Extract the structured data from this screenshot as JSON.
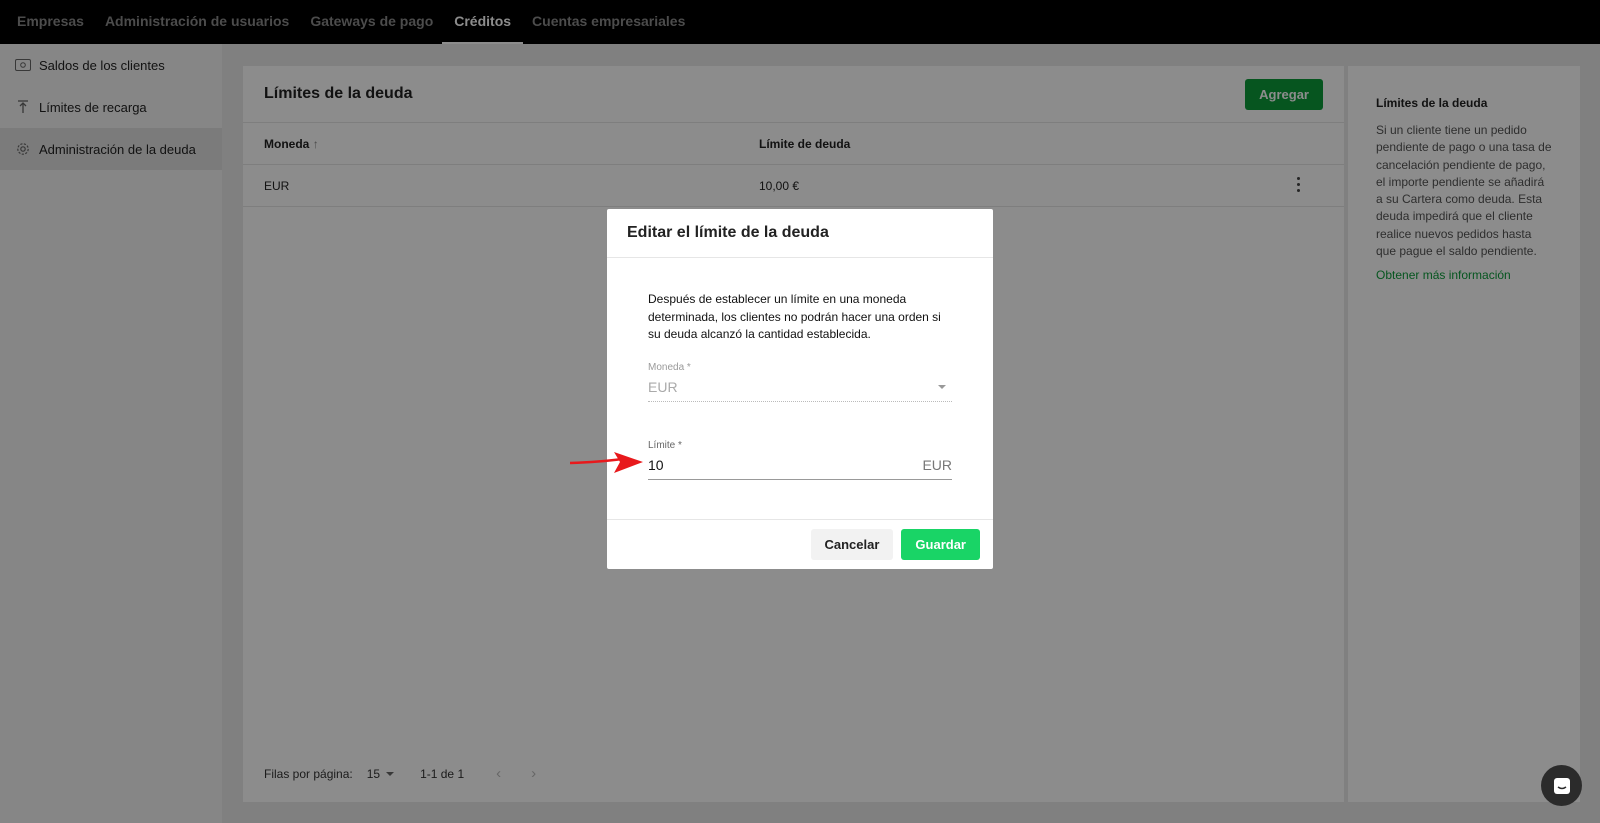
{
  "topnav": {
    "tabs": [
      {
        "label": "Empresas"
      },
      {
        "label": "Administración de usuarios"
      },
      {
        "label": "Gateways de pago"
      },
      {
        "label": "Créditos",
        "active": true
      },
      {
        "label": "Cuentas empresariales"
      }
    ]
  },
  "sidebar": {
    "items": [
      {
        "label": "Saldos de los clientes",
        "icon": "cash-icon"
      },
      {
        "label": "Límites de recarga",
        "icon": "upload-limit-icon"
      },
      {
        "label": "Administración de la deuda",
        "icon": "gear-icon",
        "active": true
      }
    ]
  },
  "main": {
    "title": "Límites de la deuda",
    "add_label": "Agregar",
    "columns": {
      "currency": "Moneda",
      "limit": "Límite de deuda"
    },
    "rows": [
      {
        "currency": "EUR",
        "limit": "10,00 €"
      }
    ],
    "footer": {
      "rows_per_page_label": "Filas por página:",
      "rows_per_page": "15",
      "range": "1-1 de 1"
    }
  },
  "help": {
    "title": "Límites de la deuda",
    "text": "Si un cliente tiene un pedido pendiente de pago o una tasa de cancelación pendiente de pago, el importe pendiente se añadirá a su Cartera como deuda. Esta deuda impedirá que el cliente realice nuevos pedidos hasta que pague el saldo pendiente.",
    "link": "Obtener más información"
  },
  "modal": {
    "title": "Editar el límite de la deuda",
    "description": "Después de establecer un límite en una moneda determinada, los clientes no podrán hacer una orden si su deuda alcanzó la cantidad establecida.",
    "currency_label": "Moneda *",
    "currency_value": "EUR",
    "limit_label": "Límite *",
    "limit_value": "10",
    "limit_suffix": "EUR",
    "cancel_label": "Cancelar",
    "save_label": "Guardar"
  },
  "colors": {
    "accent": "#0b9c3a",
    "save": "#19d466",
    "annotation_arrow": "#e8191c"
  }
}
